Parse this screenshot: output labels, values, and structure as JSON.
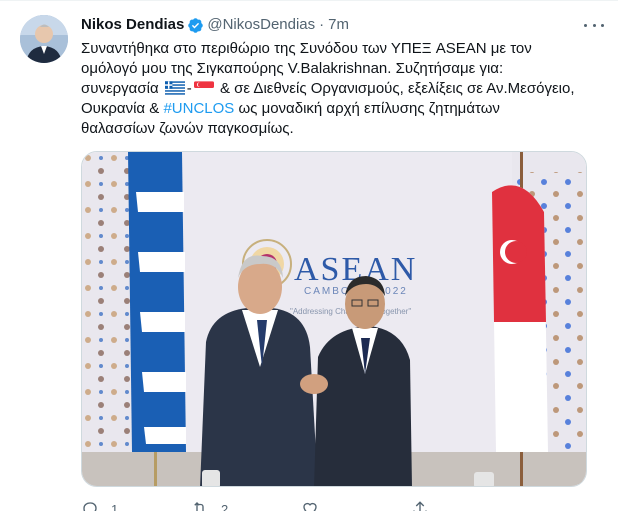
{
  "tweet": {
    "author_name": "Nikos Dendias",
    "handle": "@NikosDendias",
    "separator": "·",
    "time": "7m",
    "text": {
      "line1": "Συναντήθηκα στο περιθώριο της Συνόδου των ΥΠΕΞ ASEAN με τον",
      "line2": "ομόλογό μου της Σιγκαπούρης V.Balakrishnan. Συζητήσαμε για:",
      "line3a": "συνεργασία",
      "line3b": "& σε Διεθνείς Οργανισμούς, εξελίξεις σε Αν.Μεσόγειο,",
      "line4a": "Ουκρανία &",
      "line4_hashtag": "#UNCLOS",
      "line4b": "ως μοναδική αρχή επίλυσης ζητημάτων",
      "line5": "θαλασσίων ζωνών παγκοσμίως."
    },
    "flags": [
      "greece-flag-emoji",
      "dash",
      "singapore-flag-emoji"
    ],
    "flag_dash": "-",
    "media": {
      "banner_title": "ASEAN",
      "banner_subtitle": "CAMBODIA 2022",
      "banner_tagline": "\"Addressing Challenges Together\""
    },
    "actions": {
      "reply_count": "1",
      "retweet_count": "2",
      "like_count": "",
      "share_count": ""
    }
  },
  "colors": {
    "accent": "#1d9bf0",
    "text": "#0f1419",
    "secondary": "#536471",
    "border": "#cfd9de"
  },
  "icons": [
    "verified-badge-icon",
    "more-options-icon",
    "reply-icon",
    "retweet-icon",
    "like-icon",
    "share-icon"
  ]
}
